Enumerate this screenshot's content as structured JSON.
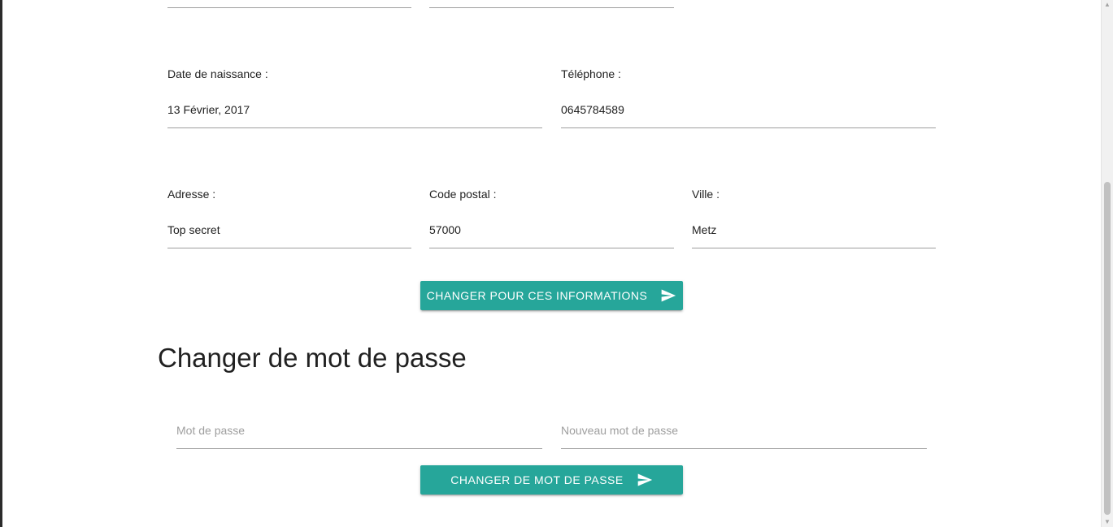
{
  "profile": {
    "birthdate": {
      "label": "Date de naissance :",
      "value": "13 Février, 2017"
    },
    "phone": {
      "label": "Téléphone :",
      "value": "0645784589"
    },
    "address": {
      "label": "Adresse :",
      "value": "Top secret"
    },
    "postal_code": {
      "label": "Code postal :",
      "value": "57000"
    },
    "city": {
      "label": "Ville :",
      "value": "Metz"
    },
    "submit_label": "CHANGER POUR CES INFORMATIONS"
  },
  "password_section": {
    "title": "Changer de mot de passe",
    "current_placeholder": "Mot de passe",
    "new_placeholder": "Nouveau mot de passe",
    "submit_label": "CHANGER DE MOT DE PASSE"
  },
  "icons": {
    "submit": "send-icon"
  },
  "colors": {
    "accent": "#26a69a",
    "underline": "#9e9e9e",
    "placeholder": "#9e9e9e"
  }
}
